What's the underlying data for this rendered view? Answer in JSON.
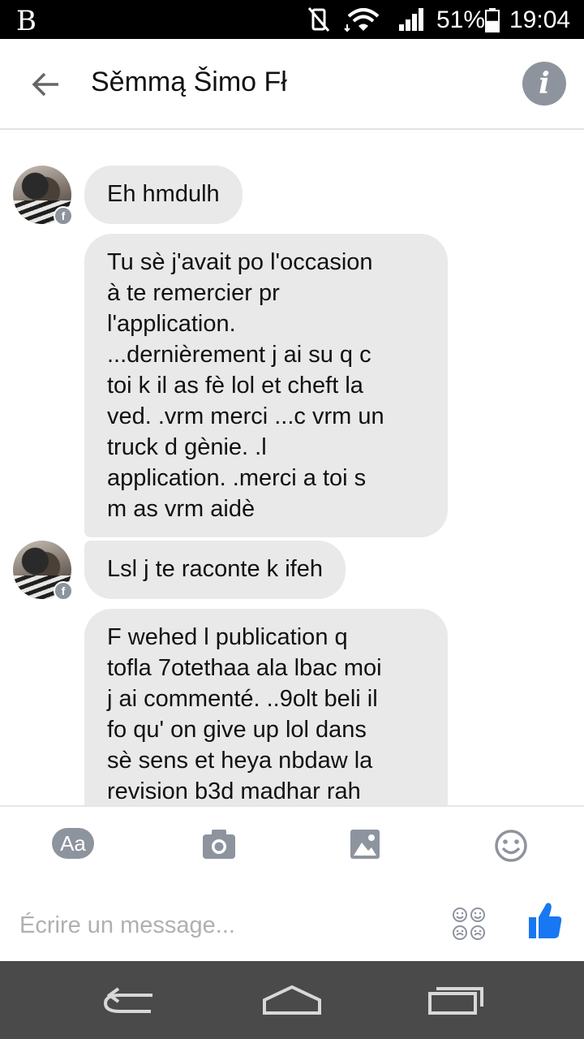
{
  "status_bar": {
    "logo": "B",
    "battery_percent": "51%",
    "battery_level": 0.51,
    "time": "19:04"
  },
  "header": {
    "contact_name": "Sěmmą Šimo Fł"
  },
  "messages": [
    {
      "text": "Eh hmdulh"
    },
    {
      "text": "Tu sè j'avait po l'occasion\nà te remercier pr\nl'application.\n...dernièrement j ai su q c\ntoi k il as fè lol et cheft la\nved. .vrm merci ...c vrm un\ntruck d gènie. .l\napplication. .merci a toi s\nm as vrm aidè"
    },
    {
      "text": "Lsl j te raconte k ifeh"
    },
    {
      "text": "F wehed l publication q\ntofla 7otethaa ala lbac moi\nj ai commenté. ..9olt beli il\nfo qu' on  give up lol dans\nsè sens  et heya nbdaw la\nrevision b3d madhar rah"
    }
  ],
  "composer": {
    "aa_label": "Aa",
    "placeholder": "Écrire un message..."
  },
  "colors": {
    "bubble_bg": "#e9e9ea",
    "icon_gray": "#8d949e",
    "like_blue": "#1877f2",
    "navbar_bg": "#4a4a4a"
  }
}
